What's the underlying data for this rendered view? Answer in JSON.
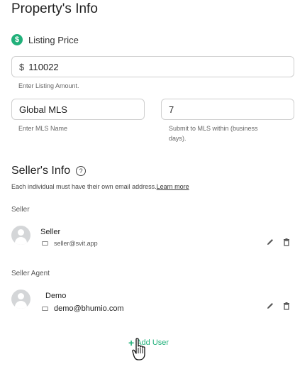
{
  "page": {
    "title": "Property's Info"
  },
  "listing": {
    "label": "Listing Price",
    "currency_symbol": "$",
    "price_value": "110022",
    "price_hint": "Enter Listing Amount.",
    "mls_name_value": "Global MLS",
    "mls_name_hint": "Enter MLS Name",
    "mls_days_value": "7",
    "mls_days_hint_line1": "Submit to MLS within (business",
    "mls_days_hint_line2": "days)."
  },
  "sellers_info": {
    "title": "Seller's Info",
    "help_symbol": "?",
    "description": "Each individual must have their own email address.",
    "learn_more": "Learn more",
    "seller_group_label": "Seller",
    "seller": {
      "name": "Seller",
      "email": "seller@svit.app"
    },
    "agent_group_label": "Seller Agent",
    "agent": {
      "name": "Demo",
      "email": "demo@bhumio.com"
    },
    "add_user_label": "Add User"
  },
  "icons": {
    "listing": "dollar-circle-icon",
    "help": "help-circle-icon",
    "email": "mail-icon",
    "edit": "pencil-icon",
    "delete": "trash-icon",
    "add": "plus-icon",
    "cursor": "hand-pointer-icon"
  },
  "colors": {
    "accent": "#21b07a",
    "border": "#cfcfcf",
    "avatar": "#d4d6d8"
  }
}
